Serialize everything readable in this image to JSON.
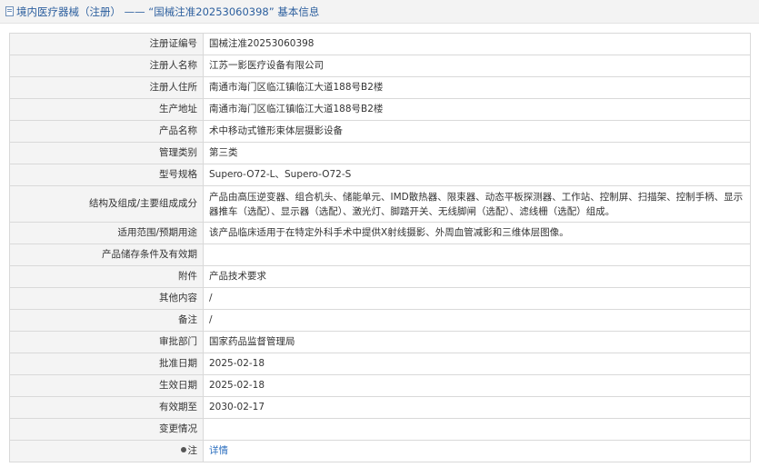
{
  "header": {
    "title": "境内医疗器械（注册） —— “国械注准20253060398” 基本信息"
  },
  "rows": [
    {
      "label": "注册证编号",
      "value": "国械注准20253060398"
    },
    {
      "label": "注册人名称",
      "value": "江苏一影医疗设备有限公司"
    },
    {
      "label": "注册人住所",
      "value": "南通市海门区临江镇临江大道188号B2楼"
    },
    {
      "label": "生产地址",
      "value": "南通市海门区临江镇临江大道188号B2楼"
    },
    {
      "label": "产品名称",
      "value": "术中移动式锥形束体层摄影设备"
    },
    {
      "label": "管理类别",
      "value": "第三类"
    },
    {
      "label": "型号规格",
      "value": "Supero-O72-L、Supero-O72-S"
    },
    {
      "label": "结构及组成/主要组成成分",
      "value": "产品由高压逆变器、组合机头、储能单元、IMD散热器、限束器、动态平板探测器、工作站、控制屏、扫描架、控制手柄、显示器推车（选配）、显示器（选配）、激光灯、脚踏开关、无线脚闸（选配）、滤线栅（选配）组成。"
    },
    {
      "label": "适用范围/预期用途",
      "value": "该产品临床适用于在特定外科手术中提供X射线摄影、外周血管减影和三维体层图像。"
    },
    {
      "label": "产品储存条件及有效期",
      "value": ""
    },
    {
      "label": "附件",
      "value": "产品技术要求"
    },
    {
      "label": "其他内容",
      "value": "/"
    },
    {
      "label": "备注",
      "value": "/"
    },
    {
      "label": "审批部门",
      "value": "国家药品监督管理局"
    },
    {
      "label": "批准日期",
      "value": "2025-02-18"
    },
    {
      "label": "生效日期",
      "value": "2025-02-18"
    },
    {
      "label": "有效期至",
      "value": "2030-02-17"
    },
    {
      "label": "变更情况",
      "value": ""
    }
  ],
  "note_row": {
    "label": "注",
    "link_text": "详情"
  },
  "colors": {
    "link": "#2c6fbf",
    "label_bg": "#f4f4f4",
    "border": "#d9d9d9"
  }
}
